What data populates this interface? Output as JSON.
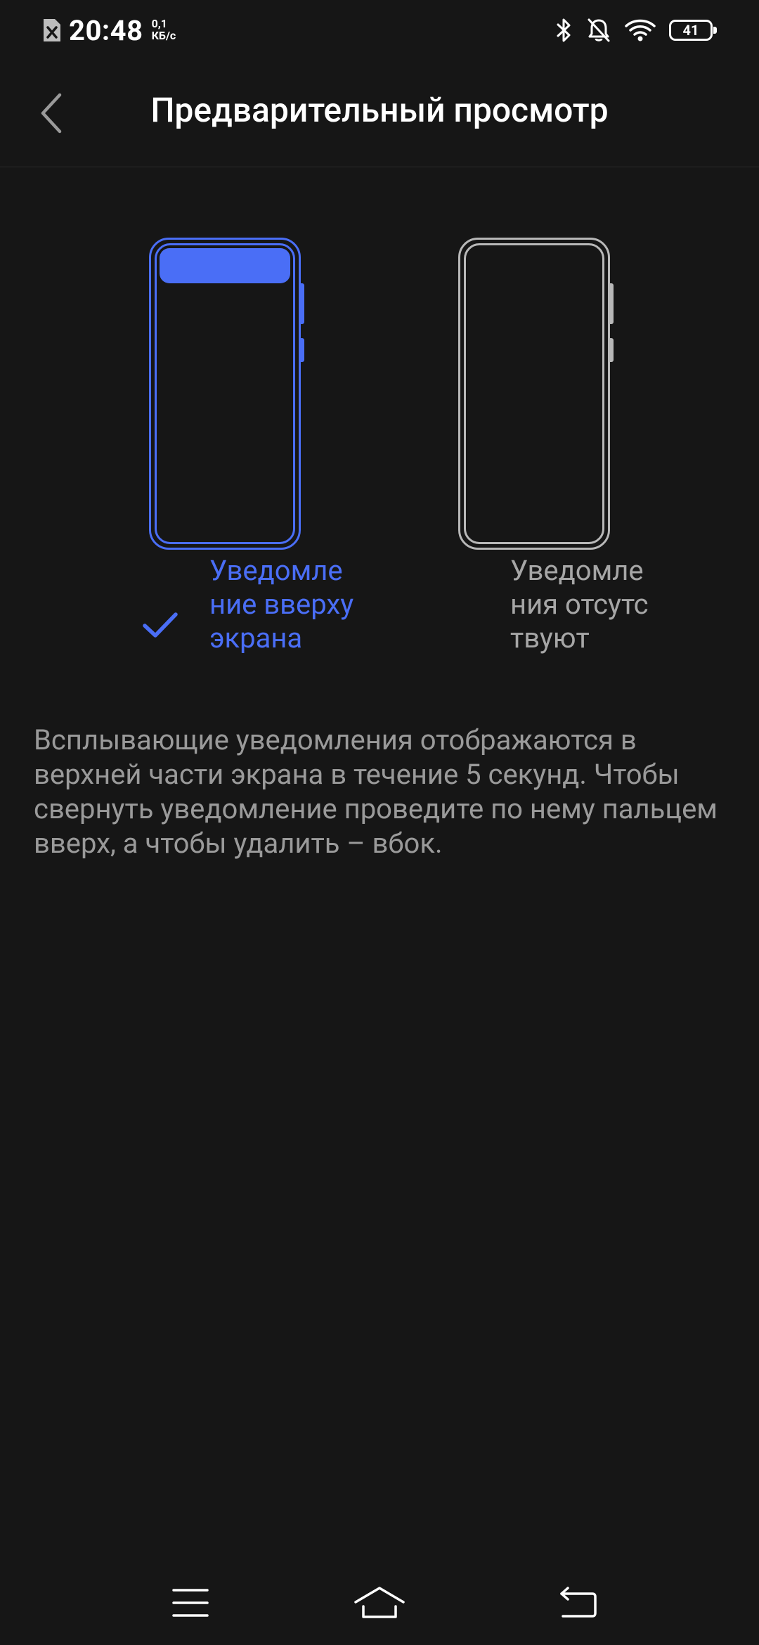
{
  "status_bar": {
    "time": "20:48",
    "speed_value": "0,1",
    "speed_unit": "КБ/с",
    "battery": "41",
    "icons": [
      "sim-missing-icon",
      "bluetooth-icon",
      "bell-muted-icon",
      "wifi-icon",
      "battery-icon"
    ]
  },
  "header": {
    "title": "Предварительный просмотр",
    "back_icon": "chevron-left-icon"
  },
  "options": [
    {
      "label": "Уведомление вверху экрана",
      "selected": true
    },
    {
      "label": "Уведомления отсутствуют",
      "selected": false
    }
  ],
  "description": "Всплывающие уведомления отображаются в верхней части экрана в течение 5 секунд. Чтобы свернуть уведомление проведите по нему пальцем вверх, а чтобы удалить – вбок.",
  "nav_bar": {
    "icons": [
      "menu-icon",
      "home-icon",
      "back-icon"
    ]
  },
  "colors": {
    "background": "#161616",
    "accent": "#4a6ef6",
    "inactive_outline": "#b8b8b8",
    "secondary_text": "#9a9a9a"
  }
}
